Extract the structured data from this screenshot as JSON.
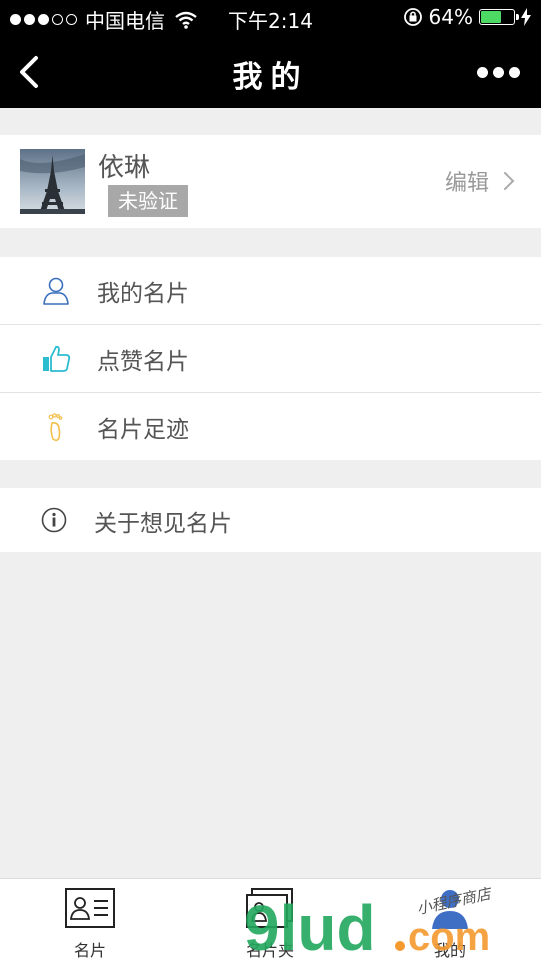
{
  "status_bar": {
    "carrier": "中国电信",
    "time": "下午2:14",
    "battery_percent": "64%",
    "battery_level": 0.64
  },
  "nav": {
    "title": "我的"
  },
  "profile": {
    "name": "依琳",
    "badge": "未验证",
    "edit_label": "编辑"
  },
  "menu": [
    {
      "label": "我的名片",
      "icon": "person-icon"
    },
    {
      "label": "点赞名片",
      "icon": "thumbs-up-icon"
    },
    {
      "label": "名片足迹",
      "icon": "footprint-icon"
    }
  ],
  "about": {
    "label": "关于想见名片",
    "icon": "info-icon"
  },
  "tabs": [
    {
      "label": "名片",
      "icon": "card-icon"
    },
    {
      "label": "名片夹",
      "icon": "card-holder-icon"
    },
    {
      "label": "我的",
      "icon": "profile-icon"
    }
  ],
  "watermark": {
    "text": "9lud.com",
    "subtext": "小程序商店"
  },
  "colors": {
    "accent_blue": "#3a6fbe",
    "accent_cyan": "#2bbcd0",
    "accent_yellow": "#f2c04a",
    "watermark_green": "#23a85e",
    "watermark_orange": "#f49a2e"
  }
}
